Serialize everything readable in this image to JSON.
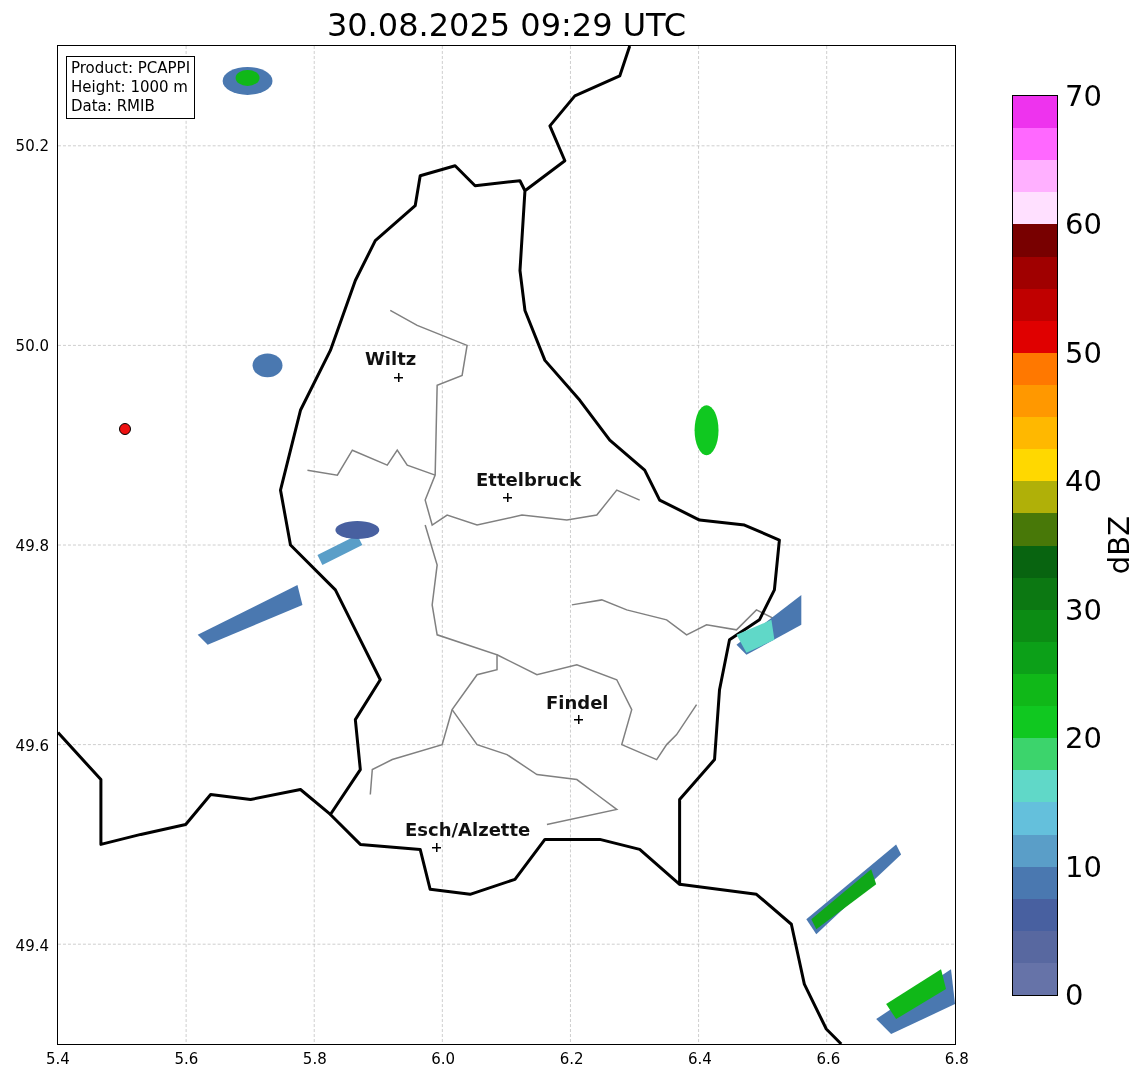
{
  "title": "30.08.2025 09:29 UTC",
  "info_box": [
    "Product: PCAPPI",
    "Height: 1000 m",
    "Data: RMIB"
  ],
  "map": {
    "x_ticks": [
      "5.4",
      "5.6",
      "5.8",
      "6.0",
      "6.2",
      "6.4",
      "6.6",
      "6.8"
    ],
    "y_ticks": [
      "50.2",
      "50.0",
      "49.8",
      "49.6",
      "49.4"
    ],
    "places": [
      {
        "label": "Wiltz"
      },
      {
        "label": "Ettelbruck"
      },
      {
        "label": "Findel"
      },
      {
        "label": "Esch/Alzette"
      }
    ]
  },
  "colorbar": {
    "label": "dBZ",
    "ticks": [
      "70",
      "60",
      "50",
      "40",
      "30",
      "20",
      "10",
      "0"
    ],
    "segments": [
      {
        "color": "#ee33ee"
      },
      {
        "color": "#ff68ff"
      },
      {
        "color": "#ffb0ff"
      },
      {
        "color": "#ffe0ff"
      },
      {
        "color": "#780000"
      },
      {
        "color": "#a00000"
      },
      {
        "color": "#c00000"
      },
      {
        "color": "#e00000"
      },
      {
        "color": "#ff7800"
      },
      {
        "color": "#ff9800"
      },
      {
        "color": "#ffb800"
      },
      {
        "color": "#ffd800"
      },
      {
        "color": "#b0b008"
      },
      {
        "color": "#487808"
      },
      {
        "color": "#086410"
      },
      {
        "color": "#0c7812"
      },
      {
        "color": "#0c8c14"
      },
      {
        "color": "#0ca018"
      },
      {
        "color": "#10b818"
      },
      {
        "color": "#10c820"
      },
      {
        "color": "#3cd46c"
      },
      {
        "color": "#60d8c8"
      },
      {
        "color": "#64c0dc"
      },
      {
        "color": "#5a9ec8"
      },
      {
        "color": "#4a78b0"
      },
      {
        "color": "#4860a0"
      },
      {
        "color": "#5868a0"
      },
      {
        "color": "#6673a8"
      }
    ]
  }
}
